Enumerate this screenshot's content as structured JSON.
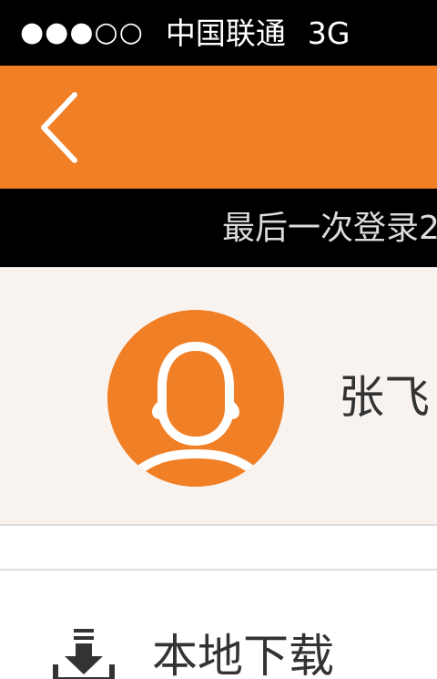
{
  "status_bar": {
    "signal": "●●●○○",
    "carrier": "中国联通",
    "network": "3G"
  },
  "nav": {
    "back_icon": "chevron-left-icon",
    "background_color": "#f07f26"
  },
  "last_login": {
    "text": "最后一次登录2"
  },
  "profile": {
    "avatar_icon": "user-avatar-icon",
    "name": "张飞"
  },
  "menu": {
    "items": [
      {
        "icon": "download-icon",
        "label": "本地下载"
      }
    ]
  },
  "colors": {
    "accent": "#f07f26",
    "profile_background": "#f8f3ef"
  }
}
